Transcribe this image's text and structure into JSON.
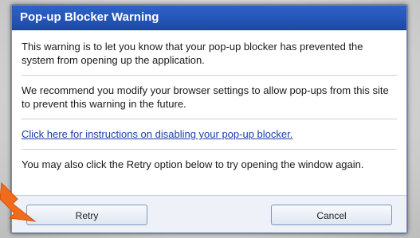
{
  "dialog": {
    "title": "Pop-up Blocker Warning",
    "paragraph1": "This warning is to let you know that your pop-up blocker has prevented the system from opening up the application.",
    "paragraph2": "We recommend you modify your browser settings to allow pop-ups from this site to prevent this warning in the future.",
    "link_text": "Click here for instructions on disabling your pop-up blocker.",
    "paragraph3": "You may also click the Retry option below to try opening the window again."
  },
  "buttons": {
    "retry_label": "Retry",
    "cancel_label": "Cancel"
  },
  "colors": {
    "titlebar": "#1d4aa8",
    "link": "#1a3fa8",
    "arrow": "#f26a1b"
  }
}
